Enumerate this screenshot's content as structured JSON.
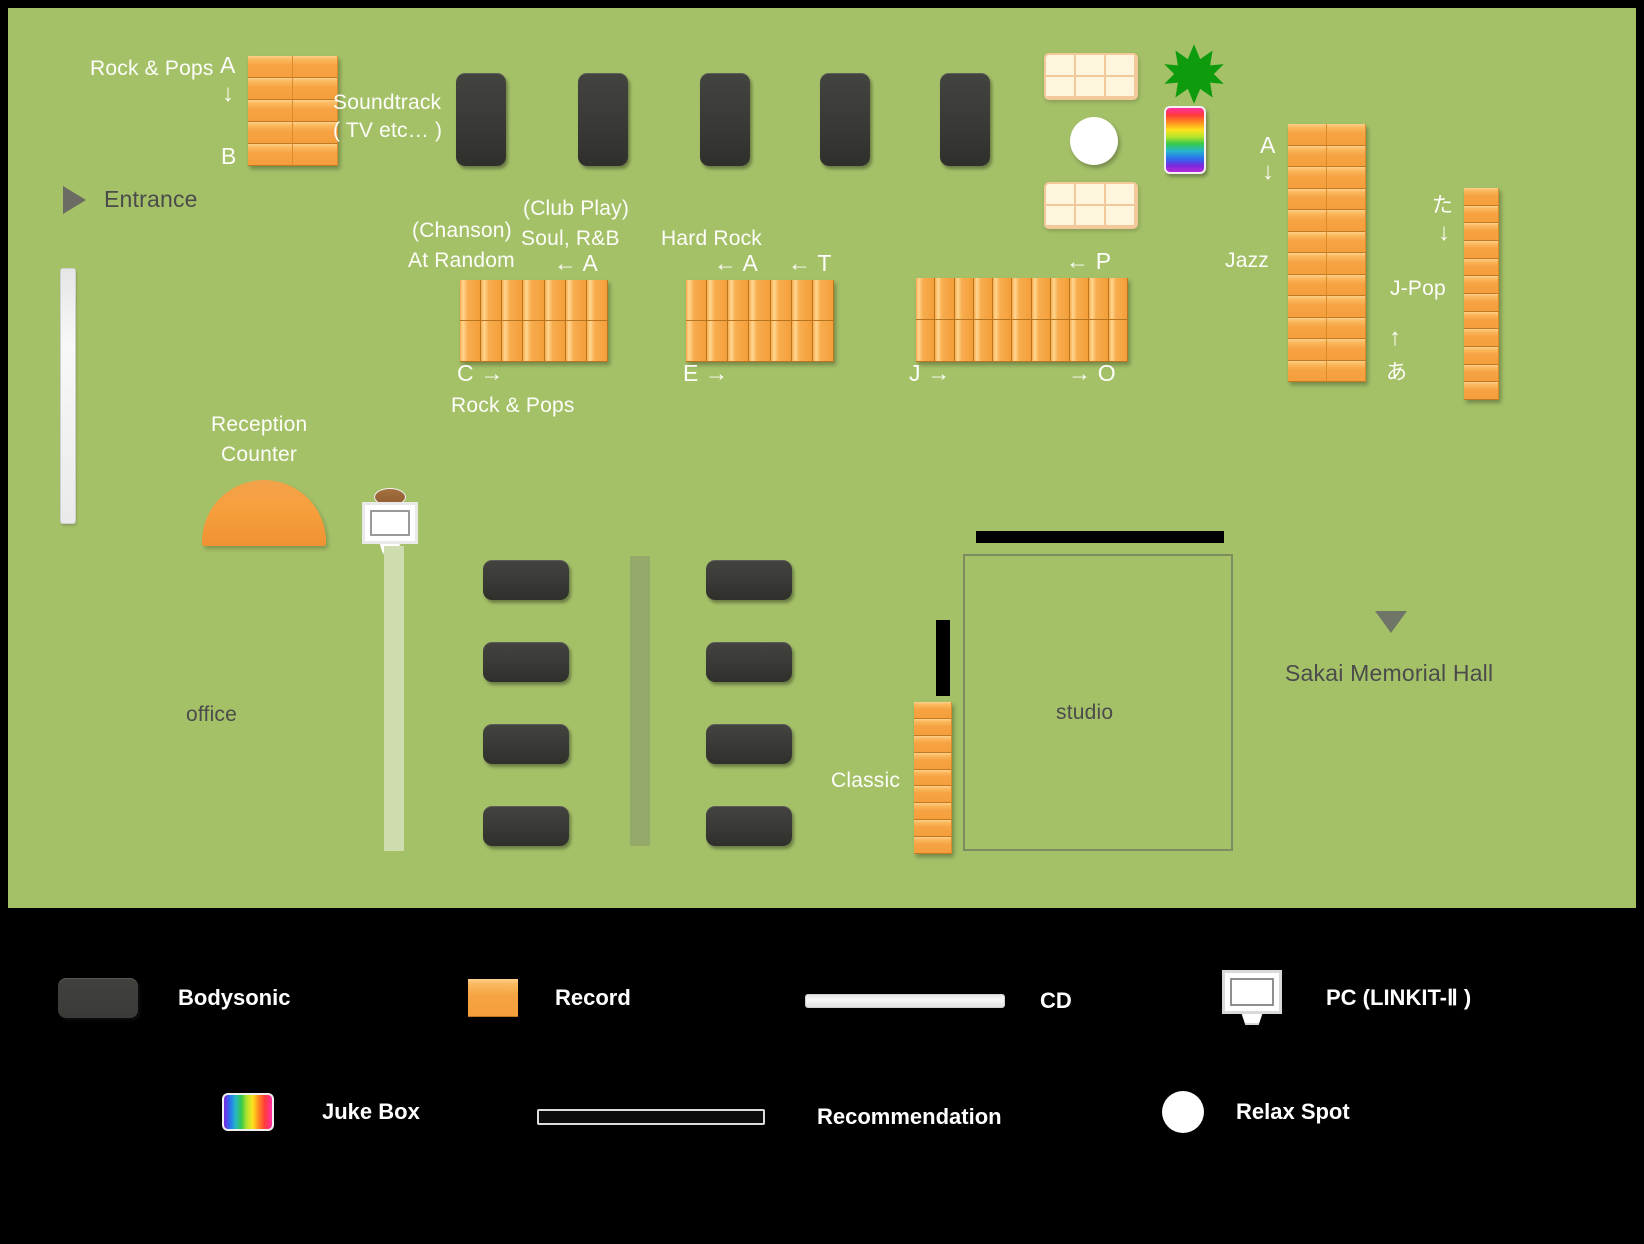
{
  "map": {
    "background_color": "#a5c168",
    "frame_color": "#000000",
    "labels": {
      "rock_pops_top": "Rock & Pops",
      "rock_pops_top_a": "A",
      "rock_pops_top_b": "B",
      "soundtrack_l1": "Soundtrack",
      "soundtrack_l2": "( TV etc… )",
      "entrance": "Entrance",
      "chanson": "(Chanson)",
      "at_random": "At Random",
      "club_play": "(Club Play)",
      "soul_rnb": "Soul, R&B",
      "hard_rock": "Hard Rock",
      "arrow_a_soul": "← A",
      "arrow_a_hard": "← A",
      "arrow_t_hard": "← T",
      "arrow_p": "← P",
      "arrow_c": "C →",
      "arrow_e": "E →",
      "arrow_j": "J →",
      "arrow_o": "→ O",
      "rock_pops_bottom": "Rock & Pops",
      "jazz": "Jazz",
      "jazz_a": "A",
      "jpop": "J-Pop",
      "jpop_ta": "た",
      "jpop_a": "あ",
      "reception_l1": "Reception",
      "reception_l2": "Counter",
      "office": "office",
      "classic": "Classic",
      "studio": "studio",
      "sakai_hall": "Sakai Memorial Hall"
    },
    "icons": {
      "entrance_marker": "triangle-right-icon",
      "hall_marker": "triangle-down-icon",
      "starburst": "starburst-icon",
      "jukebox": "jukebox-icon",
      "relax_spot": "relax-spot-icon",
      "pc_terminal": "pc-icon"
    },
    "shelves": [
      {
        "id": "soundtrack-shelf",
        "label": "Soundtrack",
        "cols": 2,
        "rows": 5,
        "orient": "horizontal"
      },
      {
        "id": "soul-rnb-shelf",
        "label": "Soul, R&B",
        "cols": 7,
        "rows": 2,
        "orient": "vertical"
      },
      {
        "id": "hard-rock-shelf",
        "label": "Hard Rock",
        "cols": 7,
        "rows": 2,
        "orient": "vertical"
      },
      {
        "id": "pop-shelf",
        "label": "J → O",
        "cols": 11,
        "rows": 2,
        "orient": "vertical"
      },
      {
        "id": "jazz-shelf",
        "label": "Jazz",
        "cols": 2,
        "rows": 12,
        "orient": "horizontal"
      },
      {
        "id": "jpop-shelf",
        "label": "J-Pop",
        "cols": 1,
        "rows": 12,
        "orient": "horizontal"
      },
      {
        "id": "classic-shelf",
        "label": "Classic",
        "cols": 1,
        "rows": 9,
        "orient": "horizontal"
      }
    ],
    "bodysonic_count_top": 5,
    "bodysonic_count_bottom": 8,
    "recommendation_shelves": 2
  },
  "legend": {
    "row1": [
      {
        "key": "bodysonic",
        "label": "Bodysonic",
        "swatch": "pod-swatch"
      },
      {
        "key": "record",
        "label": "Record",
        "swatch": "record-swatch"
      },
      {
        "key": "cd",
        "label": "CD",
        "swatch": "cd-swatch"
      },
      {
        "key": "pc",
        "label": "PC (LINKIT-Ⅱ )",
        "swatch": "pc-swatch"
      }
    ],
    "row2": [
      {
        "key": "jukebox",
        "label": "Juke Box",
        "swatch": "jukebox-swatch"
      },
      {
        "key": "recommendation",
        "label": "Recommendation",
        "swatch": "recommendation-swatch"
      },
      {
        "key": "relax",
        "label": "Relax Spot",
        "swatch": "relax-swatch"
      }
    ]
  }
}
